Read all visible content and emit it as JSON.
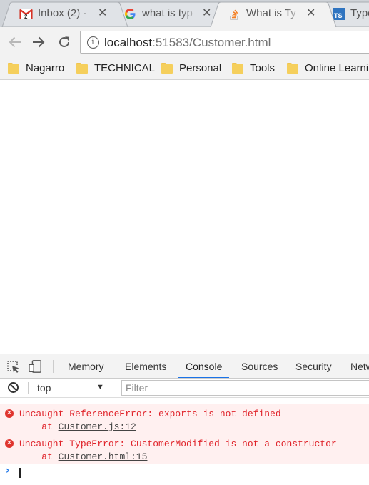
{
  "browser": {
    "tabs": [
      {
        "title": "Inbox (2) -",
        "icon": "gmail-icon",
        "active": false
      },
      {
        "title": "what is typ",
        "icon": "google-icon",
        "active": false
      },
      {
        "title": "What is Ty",
        "icon": "stackoverflow-icon",
        "active": true
      },
      {
        "title": "Type",
        "icon": "typescript-icon",
        "active": false
      }
    ],
    "close_glyph": "✕",
    "address": {
      "host": "localhost",
      "rest": ":51583/Customer.html"
    },
    "bookmarks": [
      "Nagarro",
      "TECHNICAL",
      "Personal",
      "Tools",
      "Online Learning"
    ]
  },
  "devtools": {
    "tabs": [
      "Memory",
      "Elements",
      "Console",
      "Sources",
      "Security",
      "Network"
    ],
    "active_tab": "Console",
    "context": "top",
    "filter_placeholder": "Filter",
    "messages": [
      {
        "text": "Uncaught ReferenceError: exports is not defined",
        "at": "at",
        "source": "Customer.js:12"
      },
      {
        "text": "Uncaught TypeError: CustomerModified is not a constructor",
        "at": "at",
        "source": "Customer.html:15"
      }
    ],
    "prompt_glyph": "›"
  },
  "colors": {
    "accent": "#1a73e8",
    "error": "#e0242b",
    "error_bg": "#fff0f0",
    "chrome_bg": "#f2f2f2",
    "tabstrip_bg": "#cfd3d8"
  }
}
